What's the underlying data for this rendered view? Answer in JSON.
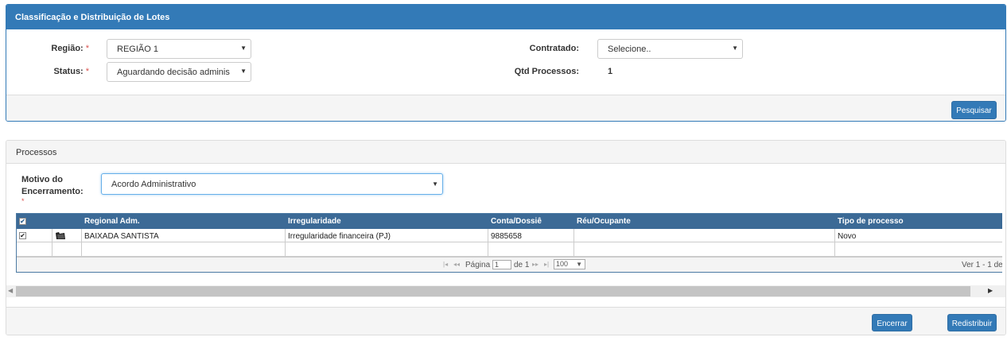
{
  "panel1": {
    "title": "Classificação e Distribuição de Lotes",
    "regiao_label": "Região:",
    "regiao_value": "REGIÃO 1",
    "status_label": "Status:",
    "status_value": "Aguardando decisão adminis",
    "required_mark": "*",
    "contratado_label": "Contratado:",
    "contratado_value": "Selecione..",
    "qtd_label": "Qtd Processos:",
    "qtd_value": "1",
    "pesquisar_label": "Pesquisar"
  },
  "panel2": {
    "title": "Processos",
    "motivo_label_line1": "Motivo do",
    "motivo_label_line2": "Encerramento:",
    "required_mark": "*",
    "motivo_value": "Acordo Administrativo",
    "encerrar_label": "Encerrar",
    "redistribuir_label": "Redistribuir"
  },
  "grid": {
    "columns": [
      "Regional Adm.",
      "Irregularidade",
      "Conta/Dossiê",
      "Réu/Ocupante",
      "Tipo de processo"
    ],
    "rows": [
      {
        "checked": true,
        "regional": "BAIXADA SANTISTA",
        "irregularidade": "Irregularidade financeira (PJ)",
        "conta": "9885658",
        "reu": "",
        "tipo": "Novo"
      }
    ],
    "pager": {
      "pagina_label": "Página",
      "page_value": "1",
      "de_label": "de 1",
      "per_page": "100",
      "records_text": "Ver 1 - 1 de"
    }
  },
  "colors": {
    "primary": "#337ab7",
    "grid_header": "#3c6a96",
    "required": "#d9534f"
  },
  "icons": {
    "folder": "folder-icon",
    "dropdown": "chevron-down-icon",
    "pager": [
      "first-page-icon",
      "prev-page-icon",
      "next-page-icon",
      "last-page-icon"
    ],
    "scroll": [
      "scroll-left-icon",
      "scroll-right-icon"
    ]
  }
}
